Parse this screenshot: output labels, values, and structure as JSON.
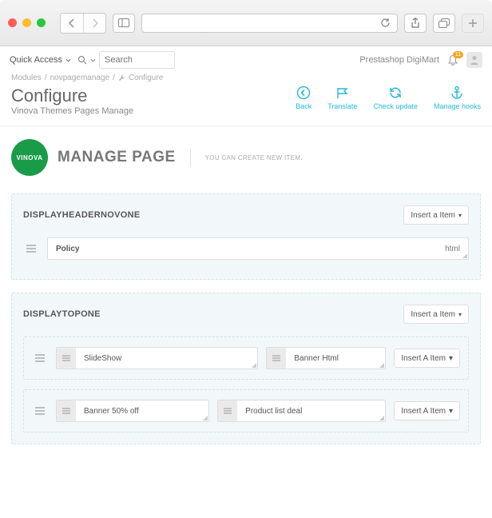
{
  "chrome": {},
  "admin": {
    "quickAccess": "Quick Access",
    "searchPlaceholder": "Search",
    "shopName": "Prestashop DigiMart",
    "notifCount": "11"
  },
  "breadcrumbs": {
    "a": "Modules",
    "b": "novpagemanage",
    "c": "Configure"
  },
  "page": {
    "title": "Configure",
    "subtitle": "Vinova Themes Pages Manage",
    "actions": {
      "back": "Back",
      "translate": "Translate",
      "check": "Check update",
      "hooks": "Manage hooks"
    }
  },
  "brand": {
    "circle": "VINOVA",
    "title": "MANAGE PAGE",
    "sub": "YOU CAN CREATE NEW ITEM."
  },
  "hooks": {
    "headerNovOne": {
      "name": "DISPLAYHEADERNOVONE",
      "insert": "Insert a Item",
      "items": [
        {
          "label": "Policy",
          "type": "html"
        }
      ]
    },
    "topOne": {
      "name": "DISPLAYTOPONE",
      "insert": "Insert a Item",
      "rows": [
        {
          "cells": [
            {
              "label": "SlideShow",
              "flex": 1
            },
            {
              "label": "Banner Html",
              "width": 150
            }
          ],
          "insert": "Insert A Item"
        },
        {
          "cells": [
            {
              "label": "Banner 50% off",
              "flex": 1
            },
            {
              "label": "Product list deal",
              "flex": 1.1
            }
          ],
          "insert": "Insert A Item"
        }
      ]
    }
  }
}
